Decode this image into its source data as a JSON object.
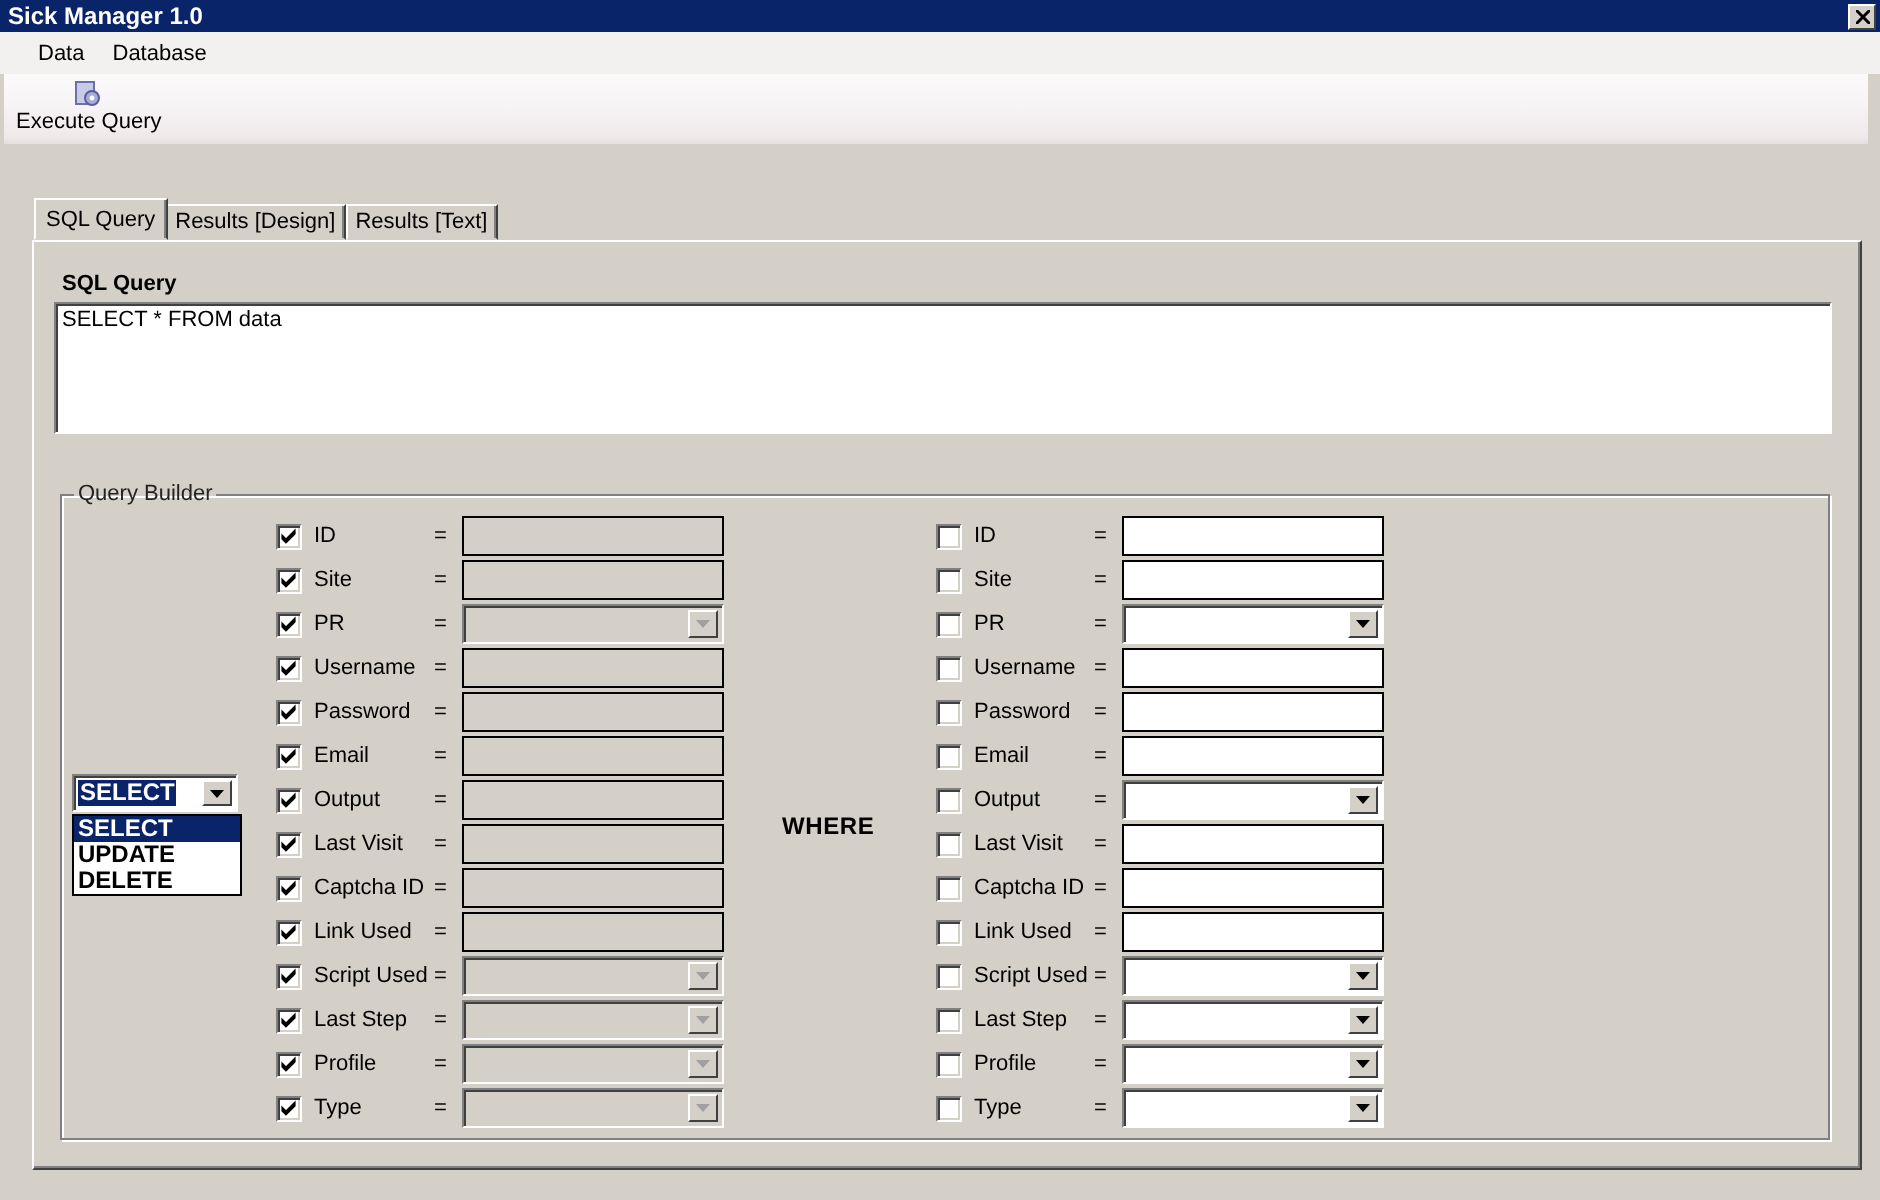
{
  "window": {
    "title": "Sick Manager 1.0"
  },
  "menu": [
    {
      "label": "Data"
    },
    {
      "label": "Database"
    }
  ],
  "toolbar": [
    {
      "label": "Execute Query"
    }
  ],
  "tabs": [
    {
      "label": "SQL Query",
      "selected": true
    },
    {
      "label": "Results [Design]",
      "selected": false
    },
    {
      "label": "Results [Text]",
      "selected": false
    }
  ],
  "sql_query": {
    "label": "SQL Query",
    "value": "SELECT * FROM data"
  },
  "query_builder": {
    "title": "Query Builder",
    "where_label": "WHERE",
    "query_type": {
      "value": "SELECT",
      "expanded": true,
      "options": [
        {
          "label": "SELECT",
          "selected": true
        },
        {
          "label": "UPDATE",
          "selected": false
        },
        {
          "label": "DELETE",
          "selected": false
        }
      ]
    },
    "select_fields": [
      {
        "label": "ID",
        "checked": true,
        "operator": "=",
        "kind": "text",
        "disabled": true
      },
      {
        "label": "Site",
        "checked": true,
        "operator": "=",
        "kind": "text",
        "disabled": true
      },
      {
        "label": "PR",
        "checked": true,
        "operator": "=",
        "kind": "combo",
        "disabled": true
      },
      {
        "label": "Username",
        "checked": true,
        "operator": "=",
        "kind": "text",
        "disabled": true
      },
      {
        "label": "Password",
        "checked": true,
        "operator": "=",
        "kind": "text",
        "disabled": true
      },
      {
        "label": "Email",
        "checked": true,
        "operator": "=",
        "kind": "text",
        "disabled": true
      },
      {
        "label": "Output",
        "checked": true,
        "operator": "=",
        "kind": "text",
        "disabled": true
      },
      {
        "label": "Last Visit",
        "checked": true,
        "operator": "=",
        "kind": "text",
        "disabled": true
      },
      {
        "label": "Captcha ID",
        "checked": true,
        "operator": "=",
        "kind": "text",
        "disabled": true
      },
      {
        "label": "Link Used",
        "checked": true,
        "operator": "=",
        "kind": "text",
        "disabled": true
      },
      {
        "label": "Script Used",
        "checked": true,
        "operator": "=",
        "kind": "combo",
        "disabled": true
      },
      {
        "label": "Last Step",
        "checked": true,
        "operator": "=",
        "kind": "combo",
        "disabled": true
      },
      {
        "label": "Profile",
        "checked": true,
        "operator": "=",
        "kind": "combo",
        "disabled": true
      },
      {
        "label": "Type",
        "checked": true,
        "operator": "=",
        "kind": "combo",
        "disabled": true
      }
    ],
    "where_fields": [
      {
        "label": "ID",
        "checked": false,
        "operator": "=",
        "kind": "text",
        "disabled": false
      },
      {
        "label": "Site",
        "checked": false,
        "operator": "=",
        "kind": "text",
        "disabled": false
      },
      {
        "label": "PR",
        "checked": false,
        "operator": "=",
        "kind": "combo",
        "disabled": false
      },
      {
        "label": "Username",
        "checked": false,
        "operator": "=",
        "kind": "text",
        "disabled": false
      },
      {
        "label": "Password",
        "checked": false,
        "operator": "=",
        "kind": "text",
        "disabled": false
      },
      {
        "label": "Email",
        "checked": false,
        "operator": "=",
        "kind": "text",
        "disabled": false
      },
      {
        "label": "Output",
        "checked": false,
        "operator": "=",
        "kind": "combo",
        "disabled": false
      },
      {
        "label": "Last Visit",
        "checked": false,
        "operator": "=",
        "kind": "text",
        "disabled": false
      },
      {
        "label": "Captcha ID",
        "checked": false,
        "operator": "=",
        "kind": "text",
        "disabled": false
      },
      {
        "label": "Link Used",
        "checked": false,
        "operator": "=",
        "kind": "text",
        "disabled": false
      },
      {
        "label": "Script Used",
        "checked": false,
        "operator": "=",
        "kind": "combo",
        "disabled": false
      },
      {
        "label": "Last Step",
        "checked": false,
        "operator": "=",
        "kind": "combo",
        "disabled": false
      },
      {
        "label": "Profile",
        "checked": false,
        "operator": "=",
        "kind": "combo",
        "disabled": false
      },
      {
        "label": "Type",
        "checked": false,
        "operator": "=",
        "kind": "combo",
        "disabled": false
      }
    ]
  }
}
